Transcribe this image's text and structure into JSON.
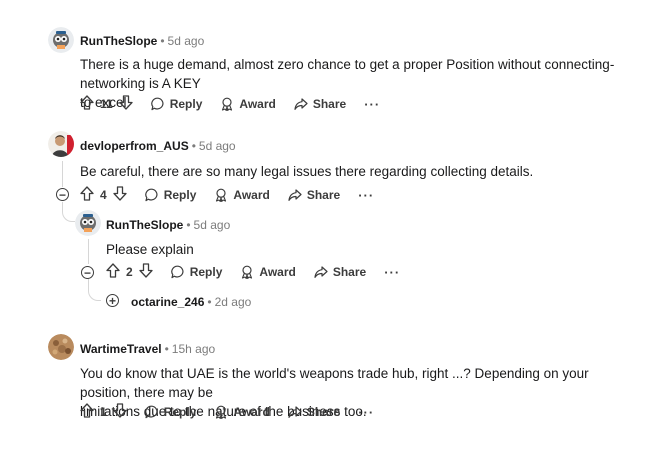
{
  "comments": [
    {
      "author": "RunTheSlope",
      "time": "5d ago",
      "body_line1": "There is a huge demand, almost zero chance to get a proper Position without connecting- networking is A KEY",
      "body_line2": "to excel.",
      "votes": "11",
      "reply_label": "Reply",
      "award_label": "Award",
      "share_label": "Share",
      "more_label": "···"
    },
    {
      "author": "devloperfrom_AUS",
      "time": "5d ago",
      "body": "Be careful, there are so many legal issues there regarding collecting details.",
      "votes": "4",
      "reply_label": "Reply",
      "award_label": "Award",
      "share_label": "Share",
      "more_label": "···",
      "collapse_symbol": "−"
    },
    {
      "author": "RunTheSlope",
      "time": "5d ago",
      "body": "Please explain",
      "votes": "2",
      "reply_label": "Reply",
      "award_label": "Award",
      "share_label": "Share",
      "more_label": "···",
      "collapse_symbol": "−"
    },
    {
      "author": "octarine_246",
      "time": "2d ago",
      "expand_symbol": "+"
    },
    {
      "author": "WartimeTravel",
      "time": "15h ago",
      "body_line1": "You do know that UAE is the world's weapons trade hub, right ...? Depending on your position, there may be",
      "body_line2": "limitations due to the nature of the business too.",
      "votes": "1",
      "reply_label": "Reply",
      "award_label": "Award",
      "share_label": "Share",
      "more_label": "···"
    }
  ],
  "icons": {
    "upvote": "arrow-up-icon",
    "downvote": "arrow-down-icon",
    "reply": "speech-bubble-icon",
    "award": "award-icon",
    "share": "share-arrow-icon"
  }
}
